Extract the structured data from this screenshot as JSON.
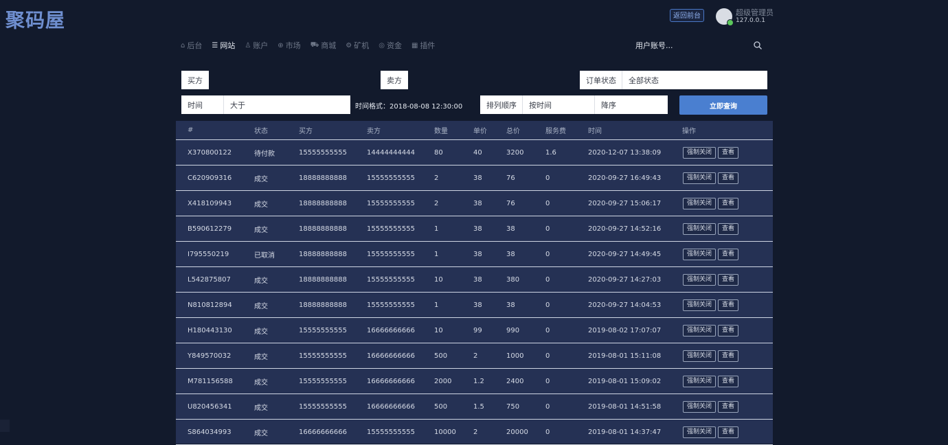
{
  "header": {
    "logo": "聚码屋",
    "back_button": "返回前台",
    "user_name": "超级管理员",
    "user_ip": "127.0.0.1",
    "status_color": "#5cc85c"
  },
  "nav": {
    "items": [
      {
        "label": "后台",
        "icon": "home-icon"
      },
      {
        "label": "网站",
        "icon": "list-icon",
        "active": true
      },
      {
        "label": "账户",
        "icon": "users-icon"
      },
      {
        "label": "市场",
        "icon": "globe-icon"
      },
      {
        "label": "商城",
        "icon": "cart-icon"
      },
      {
        "label": "矿机",
        "icon": "cog-icon"
      },
      {
        "label": "资金",
        "icon": "coin-icon"
      },
      {
        "label": "插件",
        "icon": "grid-icon"
      }
    ],
    "search_placeholder": "用户账号..."
  },
  "filters": {
    "buyer_label": "买方",
    "seller_label": "卖方",
    "order_status_label": "订单状态",
    "order_status_value": "全部状态",
    "time_label": "时间",
    "time_compare_value": "大于",
    "time_format_hint": "时间格式：2018-08-08 12:30:00",
    "sort_label": "排列顺序",
    "sort_by_value": "按时间",
    "sort_dir_value": "降序",
    "query_button": "立即查询"
  },
  "table": {
    "headers": [
      "#",
      "状态",
      "买方",
      "卖方",
      "数量",
      "单价",
      "总价",
      "服务费",
      "时间",
      "操作"
    ],
    "action_close": "强制关闭",
    "action_view": "查看",
    "rows": [
      {
        "id": "X370800122",
        "status": "待付款",
        "buyer": "15555555555",
        "seller": "14444444444",
        "qty": "80",
        "price": "40",
        "total": "3200",
        "fee": "1.6",
        "time": "2020-12-07 13:38:09"
      },
      {
        "id": "C620909316",
        "status": "成交",
        "buyer": "18888888888",
        "seller": "15555555555",
        "qty": "2",
        "price": "38",
        "total": "76",
        "fee": "0",
        "time": "2020-09-27 16:49:43"
      },
      {
        "id": "X418109943",
        "status": "成交",
        "buyer": "18888888888",
        "seller": "15555555555",
        "qty": "2",
        "price": "38",
        "total": "76",
        "fee": "0",
        "time": "2020-09-27 15:06:17"
      },
      {
        "id": "B590612279",
        "status": "成交",
        "buyer": "18888888888",
        "seller": "15555555555",
        "qty": "1",
        "price": "38",
        "total": "38",
        "fee": "0",
        "time": "2020-09-27 14:52:16"
      },
      {
        "id": "I795550219",
        "status": "已取消",
        "buyer": "18888888888",
        "seller": "15555555555",
        "qty": "1",
        "price": "38",
        "total": "38",
        "fee": "0",
        "time": "2020-09-27 14:49:45"
      },
      {
        "id": "L542875807",
        "status": "成交",
        "buyer": "18888888888",
        "seller": "15555555555",
        "qty": "10",
        "price": "38",
        "total": "380",
        "fee": "0",
        "time": "2020-09-27 14:27:03"
      },
      {
        "id": "N810812894",
        "status": "成交",
        "buyer": "18888888888",
        "seller": "15555555555",
        "qty": "1",
        "price": "38",
        "total": "38",
        "fee": "0",
        "time": "2020-09-27 14:04:53"
      },
      {
        "id": "H180443130",
        "status": "成交",
        "buyer": "15555555555",
        "seller": "16666666666",
        "qty": "10",
        "price": "99",
        "total": "990",
        "fee": "0",
        "time": "2019-08-02 17:07:07"
      },
      {
        "id": "Y849570032",
        "status": "成交",
        "buyer": "15555555555",
        "seller": "16666666666",
        "qty": "500",
        "price": "2",
        "total": "1000",
        "fee": "0",
        "time": "2019-08-01 15:11:08"
      },
      {
        "id": "M781156588",
        "status": "成交",
        "buyer": "15555555555",
        "seller": "16666666666",
        "qty": "2000",
        "price": "1.2",
        "total": "2400",
        "fee": "0",
        "time": "2019-08-01 15:09:02"
      },
      {
        "id": "U820456341",
        "status": "成交",
        "buyer": "15555555555",
        "seller": "16666666666",
        "qty": "500",
        "price": "1.5",
        "total": "750",
        "fee": "0",
        "time": "2019-08-01 14:51:58"
      },
      {
        "id": "S864034993",
        "status": "成交",
        "buyer": "16666666666",
        "seller": "15555555555",
        "qty": "10000",
        "price": "2",
        "total": "20000",
        "fee": "0",
        "time": "2019-08-01 14:37:47"
      }
    ]
  },
  "colors": {
    "background": "#121a2c",
    "table_background": "#253154",
    "accent": "#4a7fd0",
    "logo": "#6f8fd0"
  }
}
